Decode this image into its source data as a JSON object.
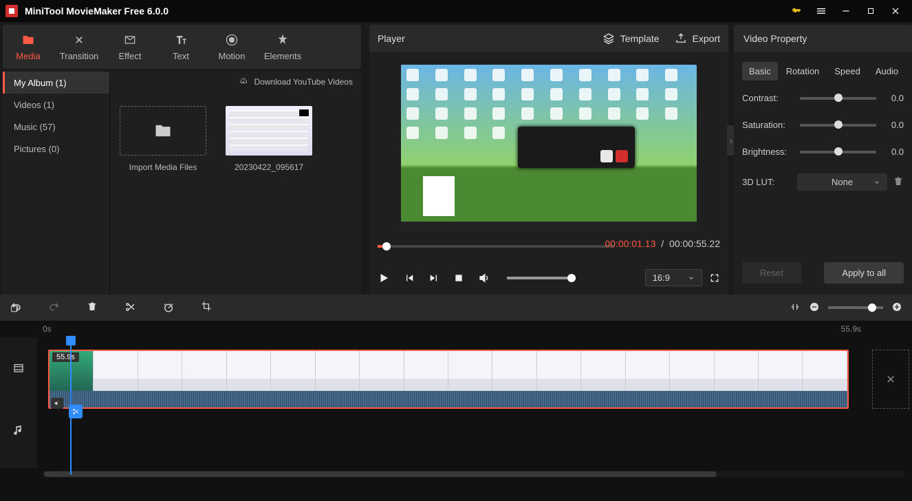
{
  "titlebar": {
    "app_title": "MiniTool MovieMaker Free 6.0.0"
  },
  "toolbar": {
    "tabs": [
      {
        "label": "Media"
      },
      {
        "label": "Transition"
      },
      {
        "label": "Effect"
      },
      {
        "label": "Text"
      },
      {
        "label": "Motion"
      },
      {
        "label": "Elements"
      }
    ]
  },
  "media": {
    "categories": [
      {
        "label": "My Album (1)"
      },
      {
        "label": "Videos (1)"
      },
      {
        "label": "Music (57)"
      },
      {
        "label": "Pictures (0)"
      }
    ],
    "download_label": "Download YouTube Videos",
    "import_label": "Import Media Files",
    "clip_name": "20230422_095617"
  },
  "player": {
    "title": "Player",
    "template_label": "Template",
    "export_label": "Export",
    "time_current": "00:00:01.13",
    "time_total": "00:00:55.22",
    "aspect_ratio": "16:9"
  },
  "props": {
    "title": "Video Property",
    "tabs": [
      "Basic",
      "Rotation",
      "Speed",
      "Audio"
    ],
    "contrast_label": "Contrast:",
    "contrast_val": "0.0",
    "saturation_label": "Saturation:",
    "saturation_val": "0.0",
    "brightness_label": "Brightness:",
    "brightness_val": "0.0",
    "lut_label": "3D LUT:",
    "lut_value": "None",
    "reset_label": "Reset",
    "apply_label": "Apply to all"
  },
  "timeline": {
    "ruler_start": "0s",
    "ruler_end": "55.9s",
    "clip_duration": "55.9s"
  }
}
